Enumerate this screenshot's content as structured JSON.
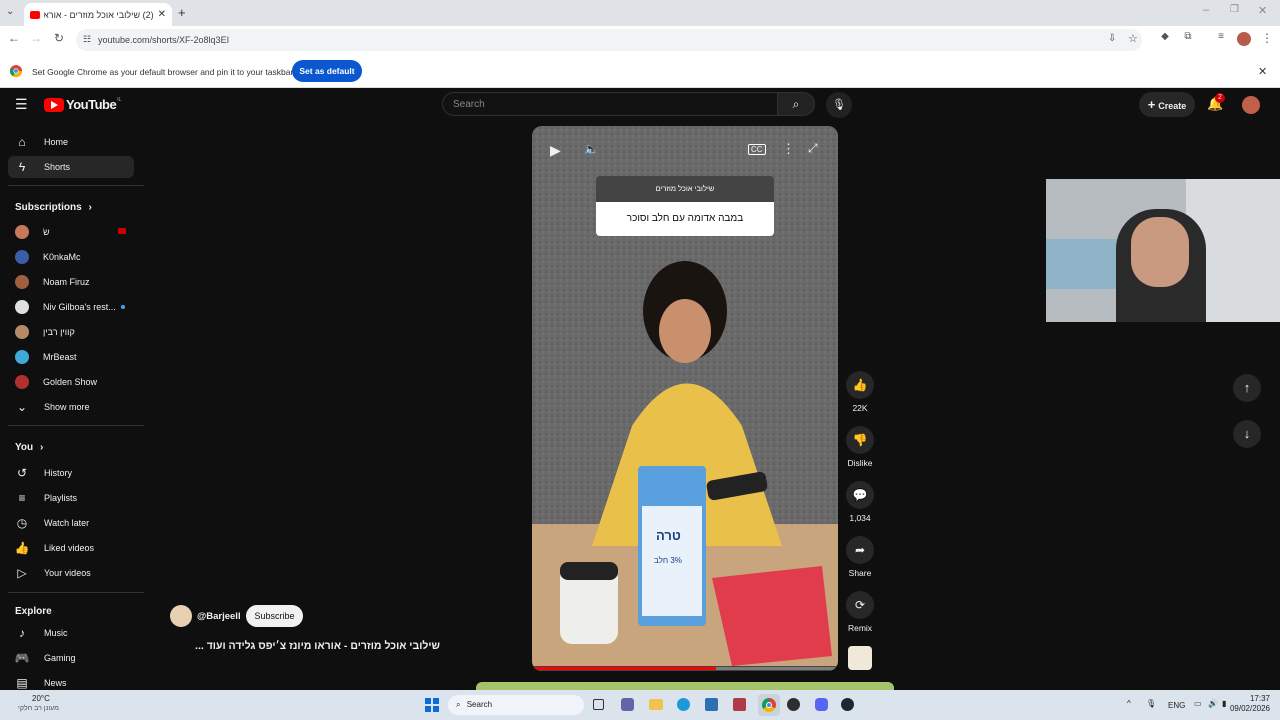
{
  "browser": {
    "tab_title": "(2) שילובי אוכל מוזרים - אוראו ה",
    "url": "youtube.com/shorts/XF-2o8lq3EI",
    "infobar_text": "Set Google Chrome as your default browser and pin it to your taskbar",
    "infobar_button": "Set as default"
  },
  "youtube": {
    "logo_text": "YouTube",
    "logo_badge": "IL",
    "search_placeholder": "Search",
    "create_label": "Create",
    "notif_count": "2"
  },
  "sidebar": {
    "home": "Home",
    "shorts": "Shorts",
    "subscriptions_heading": "Subscriptions",
    "subscriptions": [
      {
        "name": "שׂ",
        "color": "#c77a5a"
      },
      {
        "name": "K0nkaMc",
        "color": "#3b5ea8"
      },
      {
        "name": "Noam Firuz",
        "color": "#a06040"
      },
      {
        "name": "Niv Gilboa's rest...",
        "color": "#e0e0e0"
      },
      {
        "name": "קווין רבין",
        "color": "#b58a6a"
      },
      {
        "name": "MrBeast",
        "color": "#3fa9d8"
      },
      {
        "name": "Golden Show",
        "color": "#b03030"
      }
    ],
    "show_more": "Show more",
    "you_heading": "You",
    "you_items": [
      "History",
      "Playlists",
      "Watch later",
      "Liked videos",
      "Your videos"
    ],
    "explore_heading": "Explore",
    "explore_items": [
      "Music",
      "Gaming",
      "News"
    ]
  },
  "short": {
    "overlay_title": "שילובי אוכל מוזרים",
    "overlay_caption": "במבה אדומה עם חלב וסוכר",
    "milk_label": "טרה",
    "milk_sub": "3% חלב",
    "channel": "@Barjeell",
    "subscribe": "Subscribe",
    "title": "שילובי אוכל מוזרים - אוראו מיונז צ׳יפס גלידה ועוד ...",
    "progress": 0.6
  },
  "actions": {
    "likes": "22K",
    "dislike": "Dislike",
    "comments": "1,034",
    "share": "Share",
    "remix": "Remix"
  },
  "taskbar": {
    "weather_temp": "20°C",
    "weather_text": "מעונן רב חלקי",
    "search": "Search",
    "lang": "ENG",
    "time": "17:37",
    "date": "09/02/2026"
  }
}
